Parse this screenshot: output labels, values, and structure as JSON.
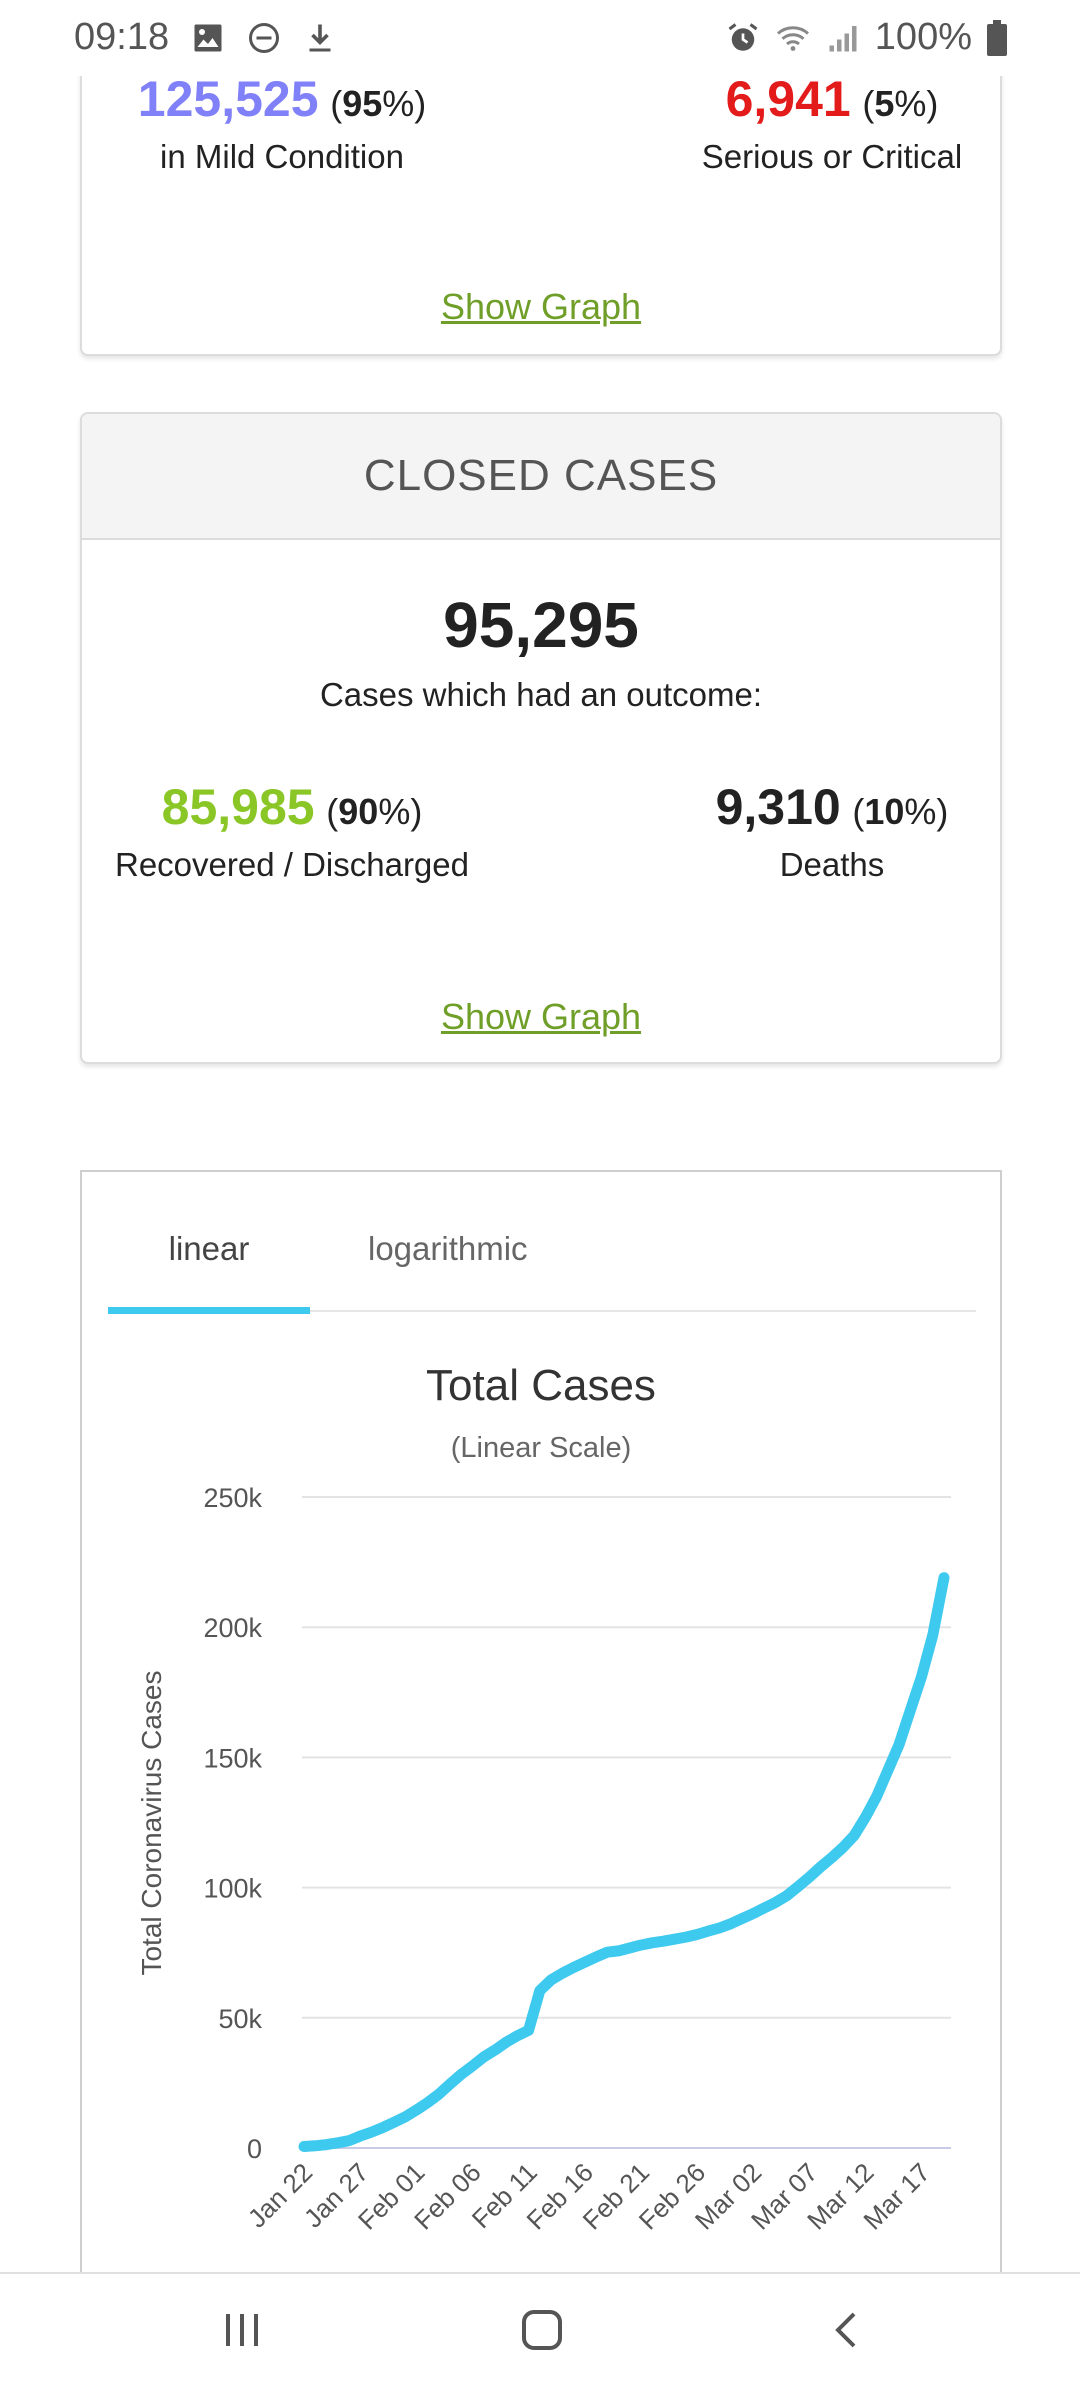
{
  "status_bar": {
    "time": "09:18",
    "battery": "100%",
    "icons": [
      "image-icon",
      "do-not-disturb-icon",
      "download-icon",
      "alarm-icon",
      "wifi-icon",
      "signal-icon",
      "battery-icon"
    ]
  },
  "active_cases_card": {
    "mild": {
      "count": "125,525",
      "percent": "95",
      "label": "in Mild Condition",
      "color": "#8080f8"
    },
    "serious": {
      "count": "6,941",
      "percent": "5",
      "label": "Serious or Critical",
      "color": "#e31b1b"
    },
    "show_graph": "Show Graph"
  },
  "closed_cases_card": {
    "header": "CLOSED CASES",
    "total": "95,295",
    "subtitle": "Cases which had an outcome:",
    "recovered": {
      "count": "85,985",
      "percent": "90",
      "label": "Recovered / Discharged",
      "color": "#8ac626"
    },
    "deaths": {
      "count": "9,310",
      "percent": "10",
      "label": "Deaths",
      "color": "#222222"
    },
    "show_graph": "Show Graph"
  },
  "chart_card": {
    "tabs": [
      {
        "label": "linear",
        "active": true
      },
      {
        "label": "logarithmic",
        "active": false
      }
    ]
  },
  "chart_data": {
    "type": "line",
    "title": "Total Cases",
    "subtitle": "(Linear Scale)",
    "ylabel": "Total Coronavirus Cases",
    "xlabel": "",
    "ylim": [
      0,
      250000
    ],
    "y_ticks": [
      0,
      50000,
      100000,
      150000,
      200000,
      250000
    ],
    "y_tick_labels": [
      "0",
      "50k",
      "100k",
      "150k",
      "200k",
      "250k"
    ],
    "x_tick_labels": [
      "Jan 22",
      "Jan 27",
      "Feb 01",
      "Feb 06",
      "Feb 11",
      "Feb 16",
      "Feb 21",
      "Feb 26",
      "Mar 02",
      "Mar 07",
      "Mar 12",
      "Mar 17"
    ],
    "series_color": "#3ec9ef",
    "grid": true,
    "series": [
      {
        "x": [
          "Jan 22",
          "Jan 23",
          "Jan 24",
          "Jan 25",
          "Jan 26",
          "Jan 27",
          "Jan 28",
          "Jan 29",
          "Jan 30",
          "Jan 31",
          "Feb 01",
          "Feb 02",
          "Feb 03",
          "Feb 04",
          "Feb 05",
          "Feb 06",
          "Feb 07",
          "Feb 08",
          "Feb 09",
          "Feb 10",
          "Feb 11",
          "Feb 12",
          "Feb 13",
          "Feb 14",
          "Feb 15",
          "Feb 16",
          "Feb 17",
          "Feb 18",
          "Feb 19",
          "Feb 20",
          "Feb 21",
          "Feb 22",
          "Feb 23",
          "Feb 24",
          "Feb 25",
          "Feb 26",
          "Feb 27",
          "Feb 28",
          "Feb 29",
          "Mar 01",
          "Mar 02",
          "Mar 03",
          "Mar 04",
          "Mar 05",
          "Mar 06",
          "Mar 07",
          "Mar 08",
          "Mar 09",
          "Mar 10",
          "Mar 11",
          "Mar 12",
          "Mar 13",
          "Mar 14",
          "Mar 15",
          "Mar 16",
          "Mar 17",
          "Mar 18",
          "Mar 19"
        ],
        "values": [
          580,
          845,
          1320,
          2010,
          2800,
          4580,
          6060,
          7820,
          9820,
          11950,
          14550,
          17390,
          20630,
          24550,
          28280,
          31500,
          34900,
          37600,
          40600,
          43100,
          45200,
          60400,
          64500,
          67100,
          69300,
          71300,
          73300,
          75200,
          75700,
          76800,
          77900,
          78800,
          79400,
          80200,
          81000,
          82000,
          83300,
          84500,
          86100,
          88100,
          90000,
          92200,
          94300,
          96900,
          100400,
          104000,
          107900,
          111500,
          115400,
          120000,
          127000,
          135000,
          145000,
          155000,
          168000,
          181000,
          197000,
          219000
        ]
      }
    ]
  },
  "nav_bar": {
    "icons": [
      "recent-apps-icon",
      "home-icon",
      "back-icon"
    ]
  }
}
